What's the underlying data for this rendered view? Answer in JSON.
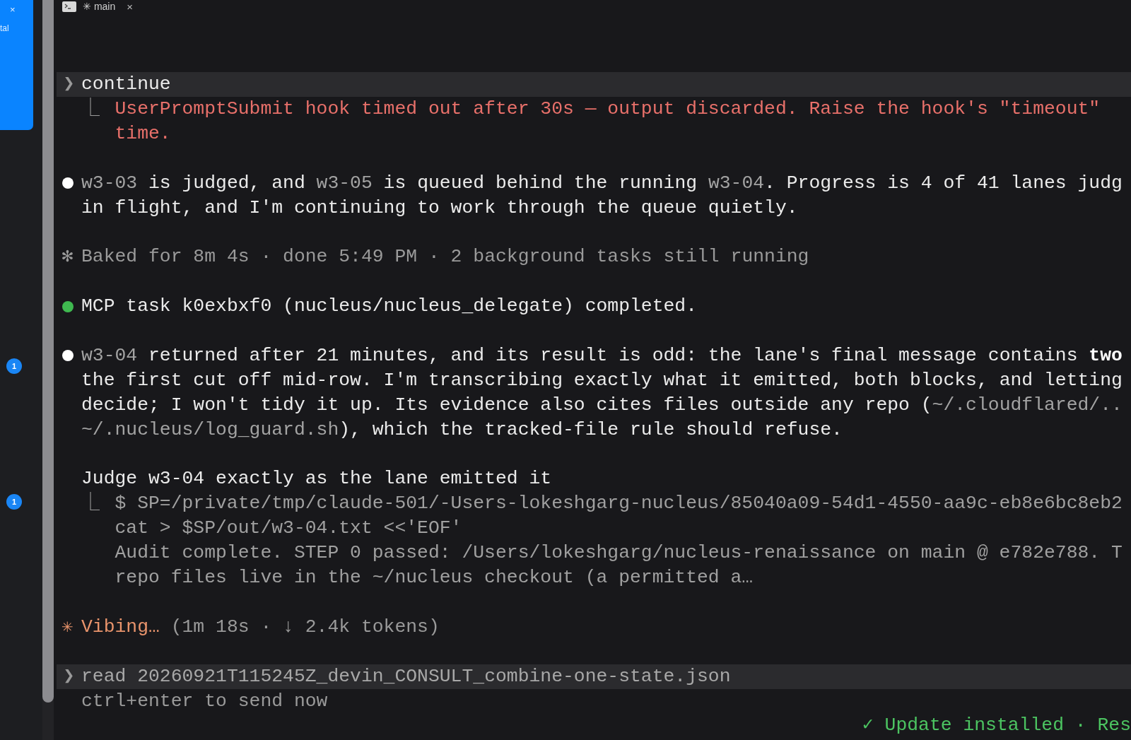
{
  "sidebar": {
    "card": {
      "close": "×",
      "label": "tal"
    },
    "badges": [
      "1",
      "1"
    ]
  },
  "tab": {
    "label": "✳ main",
    "close": "×"
  },
  "transcript": [
    {
      "kind": "prompt",
      "glyph": "❯",
      "text": "continue",
      "result": {
        "kind": "error",
        "glyph": "⎿",
        "lines": [
          "UserPromptSubmit hook timed out after 30s — output discarded. Raise the hook's \"timeout\"",
          "time."
        ]
      }
    },
    {
      "kind": "message",
      "color": "#ffffff",
      "lines": [
        [
          {
            "kind": "code",
            "text": "w3-03"
          },
          {
            "kind": "plain",
            "text": " is judged, and "
          },
          {
            "kind": "code",
            "text": "w3-05"
          },
          {
            "kind": "plain",
            "text": " is queued behind the running "
          },
          {
            "kind": "code",
            "text": "w3-04"
          },
          {
            "kind": "plain",
            "text": ". Progress is 4 of 41 lanes judg"
          }
        ],
        [
          {
            "kind": "plain",
            "text": "in flight, and I'm continuing to work through the queue quietly."
          }
        ]
      ]
    },
    {
      "kind": "status",
      "glyph": "✻",
      "text": "Baked for 8m 4s · done 5:49 PM · 2 background tasks still running"
    },
    {
      "kind": "message",
      "color": "#3fb950",
      "lines": [
        [
          {
            "kind": "plain",
            "text": "MCP task k0exbxf0 (nucleus/nucleus_delegate) completed."
          }
        ]
      ]
    },
    {
      "kind": "message",
      "color": "#ffffff",
      "lines": [
        [
          {
            "kind": "code",
            "text": "w3-04"
          },
          {
            "kind": "plain",
            "text": " returned after 21 minutes, and its result is odd: the lane's final message contains **two**"
          }
        ],
        [
          {
            "kind": "plain",
            "text": "the first cut off mid-row. I'm transcribing exactly what it emitted, both blocks, and letting"
          }
        ],
        [
          {
            "kind": "plain",
            "text": "decide; I won't tidy it up. Its evidence also cites files outside any repo ("
          },
          {
            "kind": "code",
            "text": "~/.cloudflared/.."
          }
        ],
        [
          {
            "kind": "code",
            "text": "~/.nucleus/log_guard.sh"
          },
          {
            "kind": "plain",
            "text": "), which the tracked-file rule should refuse."
          }
        ]
      ]
    },
    {
      "kind": "tool",
      "text": "Judge w3-04 exactly as the lane emitted it",
      "result": {
        "kind": "output",
        "glyph": "⎿",
        "lines": [
          "$ SP=/private/tmp/claude-501/-Users-lokeshgarg-nucleus/85040a09-54d1-4550-aa9c-eb8e6bc8eb2",
          "cat > $SP/out/w3-04.txt <<'EOF'",
          "Audit complete. STEP 0 passed: /Users/lokeshgarg/nucleus-renaissance on main @ e782e788. T",
          "repo files live in the ~/nucleus checkout (a permitted a…"
        ]
      }
    },
    {
      "kind": "spinner",
      "glyph": "✳",
      "verb": "Vibing…",
      "detail": " (1m 18s · ↓ 2.4k tokens)"
    }
  ],
  "input": {
    "glyph": "❯",
    "value": "read 20260921T115245Z_devin_CONSULT_combine-one-state.json",
    "hint": "ctrl+enter to send now"
  },
  "notice": {
    "glyph": "✓",
    "text": "Update installed · Res"
  }
}
